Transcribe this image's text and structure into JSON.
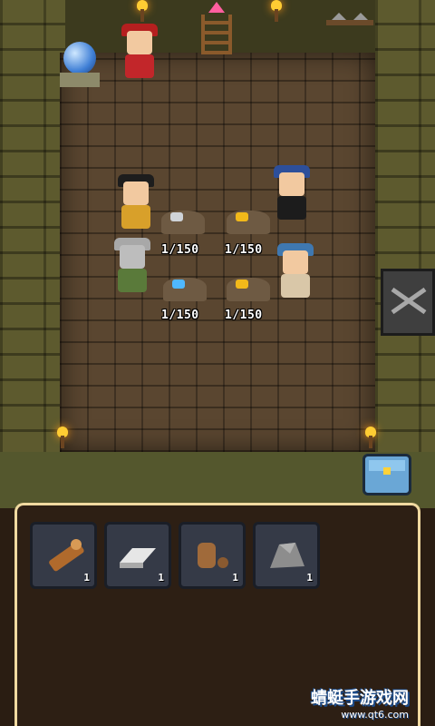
{
  "mine": {
    "stations": [
      {
        "progress": "1/150",
        "ore": "iron",
        "worker": "musketeer"
      },
      {
        "progress": "1/150",
        "ore": "gold",
        "worker": "feathered-hat"
      },
      {
        "progress": "1/150",
        "ore": "blue-crystal",
        "worker": "knight"
      },
      {
        "progress": "1/150",
        "ore": "gold",
        "worker": "goggles"
      }
    ]
  },
  "inventory": {
    "items": [
      {
        "name": "wood-log",
        "count": "1"
      },
      {
        "name": "silver-ingot",
        "count": "1"
      },
      {
        "name": "pouch",
        "count": "1"
      },
      {
        "name": "stone",
        "count": "1"
      }
    ]
  },
  "watermark": {
    "text": "蜻蜓手游戏网",
    "url": "www.qt6.com"
  },
  "colors": {
    "panel_border": "#f0d9a0",
    "slot_bg": "#353a47",
    "floor": "#5a4630"
  }
}
